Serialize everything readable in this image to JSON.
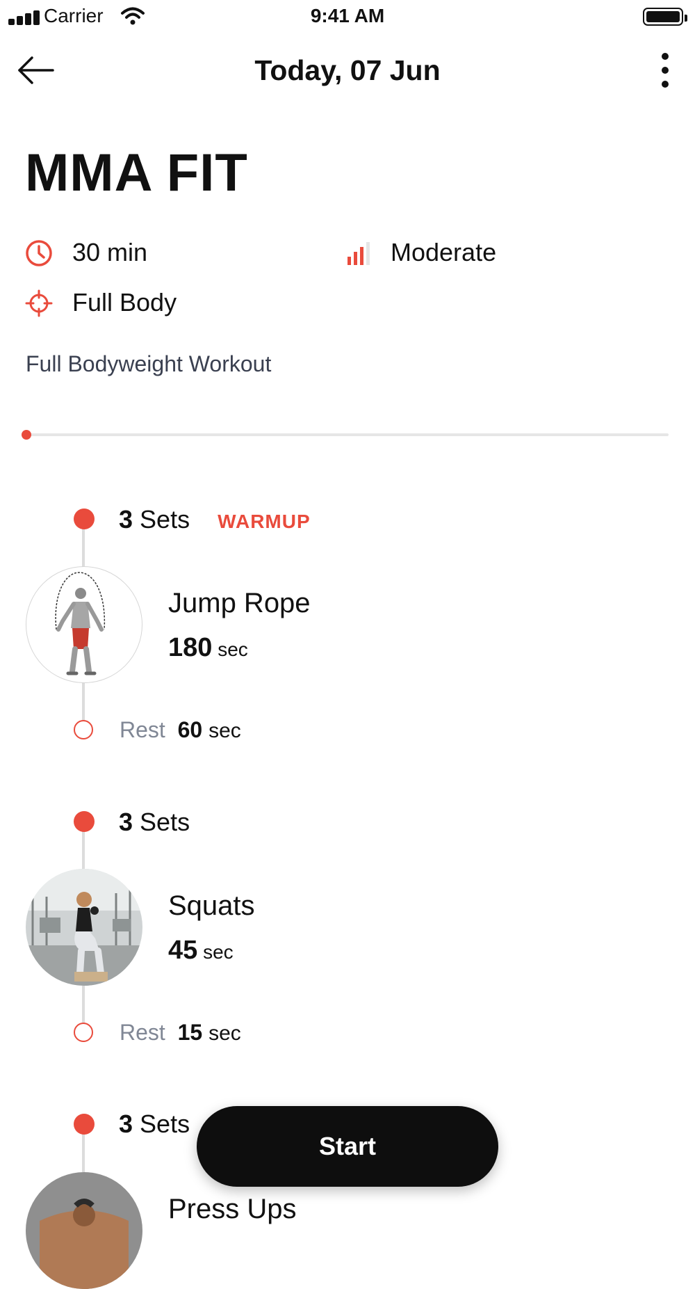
{
  "status_bar": {
    "carrier": "Carrier",
    "time": "9:41 AM"
  },
  "nav": {
    "title": "Today, 07 Jun"
  },
  "workout": {
    "title": "MMA FIT",
    "duration": "30 min",
    "difficulty": "Moderate",
    "focus": "Full Body",
    "description": "Full Bodyweight Workout",
    "progress": 0.0
  },
  "exercises": [
    {
      "sets_count": "3",
      "sets_label": "Sets",
      "tag": "WARMUP",
      "name": "Jump Rope",
      "duration_value": "180",
      "duration_unit": "sec",
      "rest_label": "Rest",
      "rest_value": "60",
      "rest_unit": "sec"
    },
    {
      "sets_count": "3",
      "sets_label": "Sets",
      "name": "Squats",
      "duration_value": "45",
      "duration_unit": "sec",
      "rest_label": "Rest",
      "rest_value": "15",
      "rest_unit": "sec"
    },
    {
      "sets_count": "3",
      "sets_label": "Sets",
      "name": "Press Ups"
    }
  ],
  "start_button": {
    "label": "Start"
  },
  "colors": {
    "accent": "#e94b3c",
    "button": "#0e0e0e",
    "timeline": "#dcdcdc"
  },
  "icons": [
    "back-arrow-icon",
    "more-vertical-icon",
    "clock-icon",
    "signal-bars-icon",
    "target-icon",
    "wifi-icon",
    "battery-icon"
  ]
}
